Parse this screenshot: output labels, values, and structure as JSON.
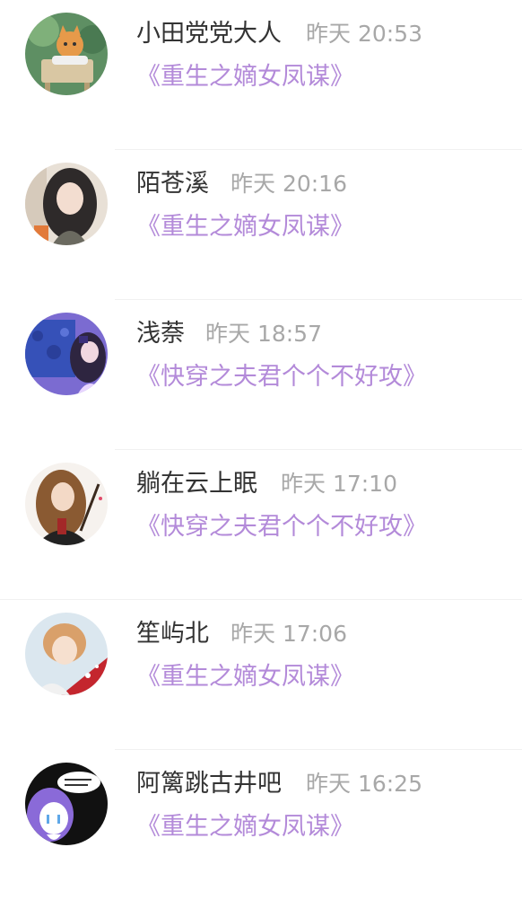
{
  "comments": [
    {
      "name": "小田党党大人",
      "time": "昨天 20:53",
      "book": "《重生之嫡女凤谋》"
    },
    {
      "name": "陌苍溪",
      "time": "昨天 20:16",
      "book": "《重生之嫡女凤谋》"
    },
    {
      "name": "浅萘",
      "time": "昨天 18:57",
      "book": "《快穿之夫君个个不好攻》"
    },
    {
      "name": "躺在云上眠",
      "time": "昨天 17:10",
      "book": "《快穿之夫君个个不好攻》"
    },
    {
      "name": "笙屿北",
      "time": "昨天 17:06",
      "book": "《重生之嫡女凤谋》"
    },
    {
      "name": "阿篱跳古井吧",
      "time": "昨天 16:25",
      "book": "《重生之嫡女凤谋》"
    }
  ],
  "colors": {
    "name": "#333333",
    "time": "#a8a8a8",
    "book_link": "#b38ad9",
    "divider": "#f0f0f0"
  }
}
